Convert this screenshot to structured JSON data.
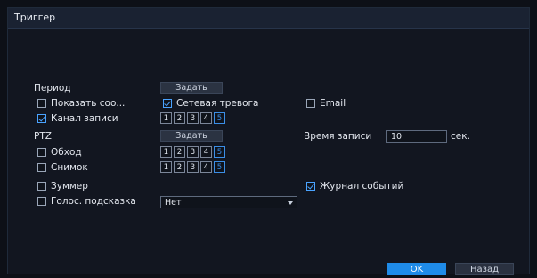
{
  "dialog": {
    "title": "Триггер"
  },
  "period": {
    "label": "Период",
    "button": "Задать"
  },
  "show_message": {
    "label": "Показать соо...",
    "checked": false
  },
  "network_alarm": {
    "label": "Сетевая тревога",
    "checked": true
  },
  "email": {
    "label": "Email",
    "checked": false
  },
  "record_channel": {
    "label": "Канал записи",
    "checked": true,
    "channels": [
      "1",
      "2",
      "3",
      "4",
      "5"
    ]
  },
  "ptz": {
    "label": "PTZ",
    "button": "Задать"
  },
  "record_time": {
    "label": "Время записи",
    "value": "10",
    "unit": "сек."
  },
  "tour": {
    "label": "Обход",
    "checked": false,
    "channels": [
      "1",
      "2",
      "3",
      "4",
      "5"
    ]
  },
  "snapshot": {
    "label": "Снимок",
    "checked": false,
    "channels": [
      "1",
      "2",
      "3",
      "4",
      "5"
    ]
  },
  "buzzer": {
    "label": "Зуммер",
    "checked": false
  },
  "event_log": {
    "label": "Журнал событий",
    "checked": true
  },
  "voice_prompt": {
    "label": "Голос. подсказка",
    "checked": false,
    "selected": "Нет"
  },
  "footer": {
    "ok": "OK",
    "back": "Назад"
  }
}
